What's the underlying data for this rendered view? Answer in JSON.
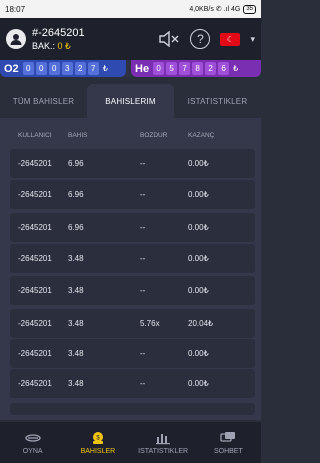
{
  "statusbar": {
    "time": "18:07",
    "network": "4,0KB/s ✆ .ıl 4G ",
    "battery": "35"
  },
  "header": {
    "user_id": "#-2645201",
    "balance_label": "BAK.:",
    "balance_value": "0 ₺"
  },
  "ticker": {
    "left": {
      "label": "O2",
      "digits": [
        "0",
        "0",
        "0",
        "3",
        "2",
        "7"
      ],
      "currency": "₺"
    },
    "right": {
      "label": "He",
      "digits": [
        "0",
        "5",
        "7",
        "8",
        "2",
        "6"
      ],
      "currency": "₺"
    }
  },
  "tabs": [
    {
      "label": "TÜM BAHISLER"
    },
    {
      "label": "BAHISLERIM"
    },
    {
      "label": "ISTATISTIKLER"
    }
  ],
  "table": {
    "headers": [
      "KULLANICI",
      "BAHIS",
      "BOZDUR",
      "KAZANÇ"
    ],
    "rows": [
      [
        "-2645201",
        "6.96",
        "--",
        "0.00₺"
      ],
      [
        "-2645201",
        "6.96",
        "--",
        "0.00₺"
      ],
      [
        "-2645201",
        "6.96",
        "--",
        "0.00₺"
      ],
      [
        "-2645201",
        "3.48",
        "--",
        "0.00₺"
      ],
      [
        "-2645201",
        "3.48",
        "--",
        "0.00₺"
      ],
      [
        "-2645201",
        "3.48",
        "5.76x",
        "20.04₺"
      ],
      [
        "-2645201",
        "3.48",
        "--",
        "0.00₺"
      ],
      [
        "-2645201",
        "3.48",
        "--",
        "0.00₺"
      ]
    ]
  },
  "nav": [
    {
      "label": "OYNA",
      "icon": "airplane-icon"
    },
    {
      "label": "BAHISLER",
      "icon": "coins-icon"
    },
    {
      "label": "ISTATISTIKLER",
      "icon": "bar-chart-icon"
    },
    {
      "label": "SOHBET",
      "icon": "chat-icon"
    }
  ],
  "colors": {
    "accent": "#f1c40f",
    "panel": "#34384a",
    "flag": "#e30a17"
  }
}
